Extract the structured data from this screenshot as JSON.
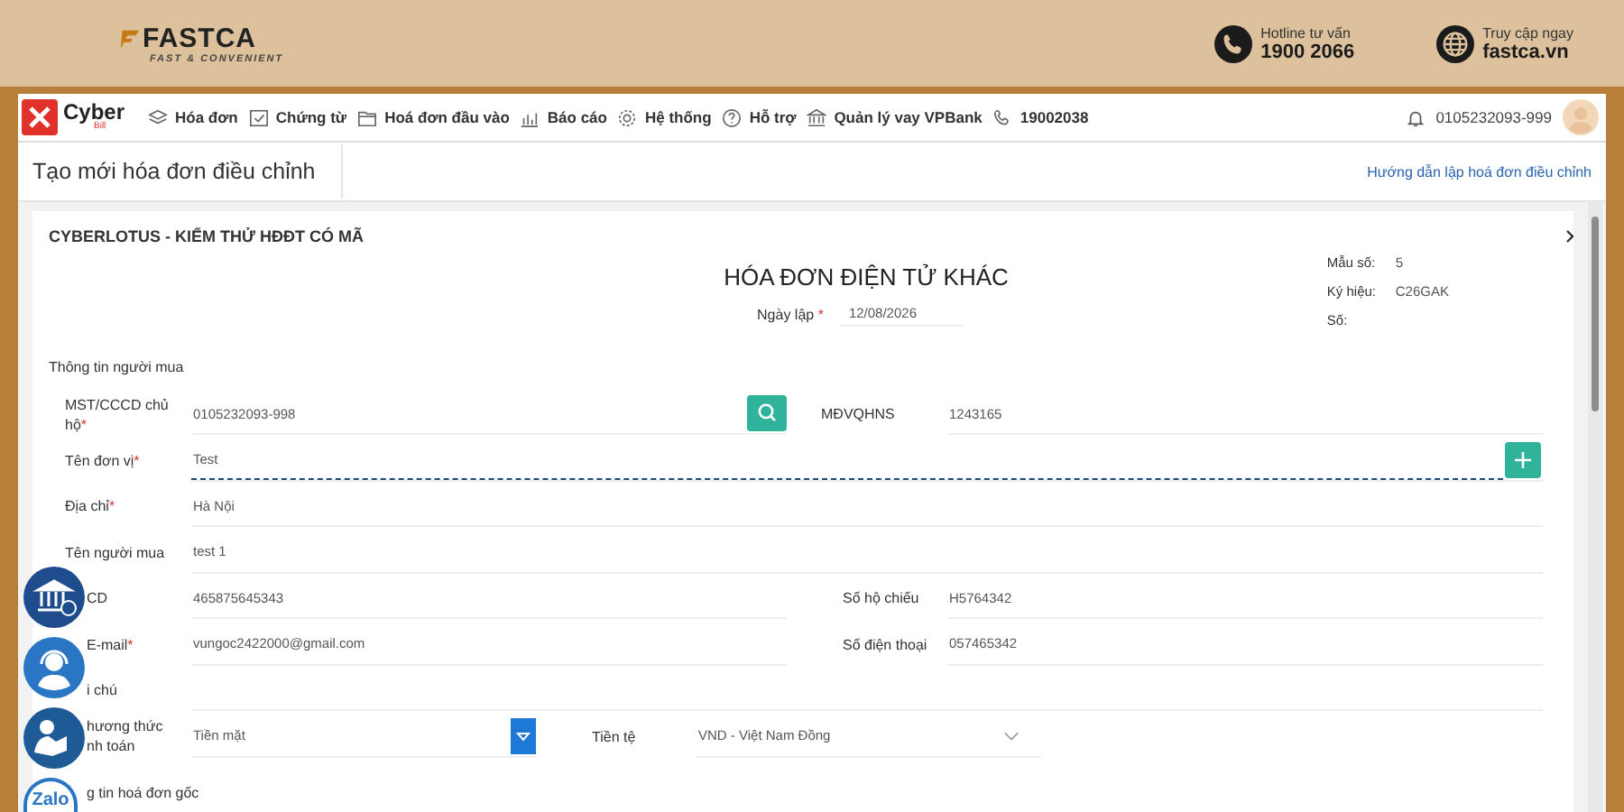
{
  "banner": {
    "brand": "FASTCA",
    "tagline": "FAST & CONVENIENT",
    "contacts": [
      {
        "kind": "phone",
        "label": "Hotline tư vấn",
        "value": "1900 2066"
      },
      {
        "kind": "web",
        "label": "Truy cập ngay",
        "value": "fastca.vn"
      }
    ]
  },
  "navbar": {
    "logo": {
      "name": "Cyber",
      "sub": "Bill"
    },
    "menu": [
      {
        "kind": "layers",
        "label": "Hóa đơn"
      },
      {
        "kind": "check",
        "label": "Chứng từ"
      },
      {
        "kind": "folder",
        "label": "Hoá đơn đầu vào"
      },
      {
        "kind": "chart",
        "label": "Báo cáo"
      },
      {
        "kind": "gear",
        "label": "Hệ thống"
      },
      {
        "kind": "help",
        "label": "Hỗ trợ"
      },
      {
        "kind": "bank",
        "label": "Quản lý vay VPBank"
      },
      {
        "kind": "phone",
        "label": "19002038"
      }
    ],
    "account": "0105232093-999"
  },
  "page": {
    "title": "Tạo mới hóa đơn điều chỉnh",
    "help_link": "Hướng dẫn lập hoá đơn điều chỉnh"
  },
  "invoice": {
    "company": "CYBERLOTUS - KIỂM THỬ HĐĐT CÓ MÃ",
    "title": "HÓA ĐƠN ĐIỆN TỬ KHÁC",
    "date_label": "Ngày lập",
    "date_mark": "*",
    "date": "12/08/2026",
    "meta": [
      {
        "label": "Mẫu số:",
        "value": "5"
      },
      {
        "label": "Ký hiệu:",
        "value": "C26GAK"
      },
      {
        "label": "Số:"
      }
    ]
  },
  "buyer": {
    "heading": "Thông tin người mua",
    "rows": [
      [
        {
          "kind": "search",
          "label": "MST/CCCD chủ hộ",
          "mark": "*",
          "value": "0105232093-998"
        },
        {
          "kind": "text",
          "label": "MĐVQHNS",
          "value": "1243165"
        }
      ],
      [
        {
          "kind": "add",
          "label": "Tên đơn vị",
          "mark": "*",
          "value": "Test"
        }
      ],
      [
        {
          "kind": "text",
          "label": "Địa chỉ",
          "mark": "*",
          "value": "Hà Nội"
        }
      ],
      [
        {
          "kind": "text",
          "label": "Tên người mua",
          "value": "test 1"
        }
      ],
      [
        {
          "kind": "text",
          "label": "CD",
          "value": "465875645343"
        },
        {
          "kind": "text",
          "label": "Số hộ chiếu",
          "value": "H5764342"
        }
      ],
      [
        {
          "kind": "text",
          "label": "E-mail",
          "mark": "*",
          "value": "vungoc2422000@gmail.com"
        },
        {
          "kind": "text",
          "label": "Số điện thoại",
          "value": "057465342"
        }
      ],
      [
        {
          "kind": "text",
          "label": "i chú"
        }
      ],
      [
        {
          "kind": "select",
          "label": "hương thức nh toán",
          "value": "Tiền mặt"
        },
        {
          "kind": "dropdown",
          "label": "Tiền tệ",
          "value": "VND - Việt Nam Đồng"
        }
      ]
    ]
  },
  "original_section": "g tin hoá đơn gốc",
  "side_buttons": [
    {
      "kind": "bank"
    },
    {
      "kind": "support"
    },
    {
      "kind": "reader"
    },
    {
      "kind": "zalo",
      "label": "Zalo"
    }
  ]
}
